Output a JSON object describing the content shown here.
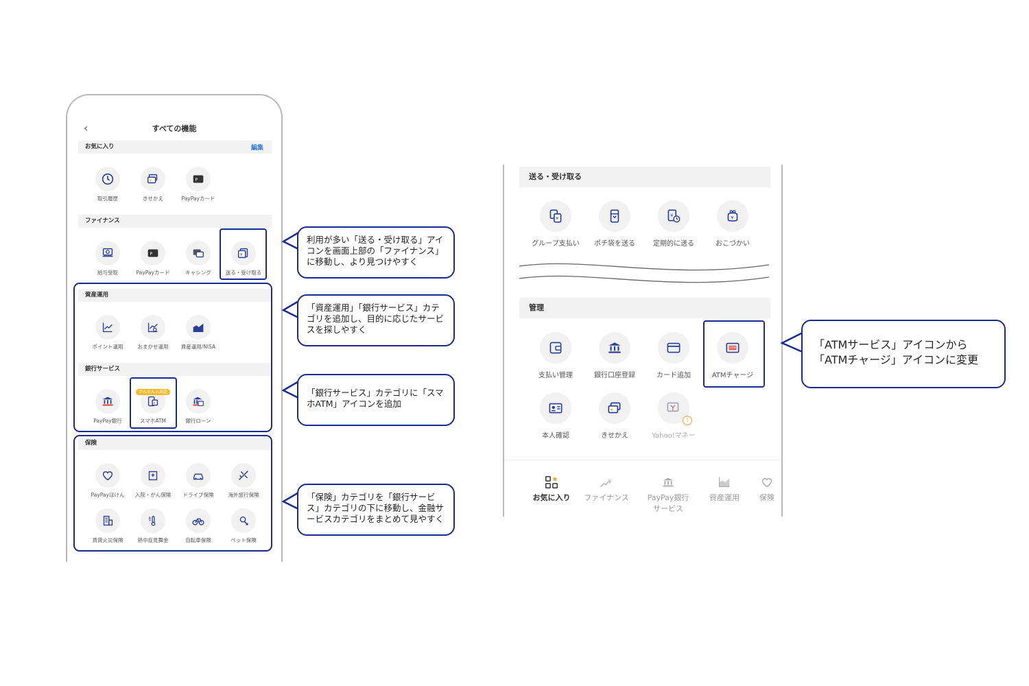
{
  "left_phone": {
    "title": "すべての機能",
    "favorites": {
      "label": "お気に入り",
      "edit": "編集",
      "items": [
        "取引履歴",
        "きせかえ",
        "PayPayカード"
      ]
    },
    "finance": {
      "label": "ファイナンス",
      "items": [
        "給与受取",
        "PayPayカード",
        "キャシング",
        "送る・受け取る"
      ]
    },
    "asset": {
      "label": "資産運用",
      "items": [
        "ポイント運用",
        "おまかせ運用",
        "資産運用/NISA"
      ]
    },
    "bank": {
      "label": "銀行サービス",
      "items": [
        "PayPay銀行",
        "スマホATM",
        "銀行ローン"
      ],
      "badge": "かんたん入出金"
    },
    "insurance": {
      "label": "保険",
      "items": [
        "PayPayほけん",
        "入院・がん保険",
        "ドライブ保険",
        "海外旅行保険",
        "賃貸火災保険",
        "熱中症見舞金",
        "自転車保険",
        "ペット保険"
      ]
    }
  },
  "callouts": {
    "c1": "利用が多い「送る・受け取る」アイコンを画面上部の「ファイナンス」に移動し、より見つけやすく",
    "c2": "「資産運用」「銀行サービス」カテゴリを追加し、目的に応じたサービスを探しやすく",
    "c3": "「銀行サービス」カテゴリに「スマホATM」アイコンを追加",
    "c4": "「保険」カテゴリを「銀行サービス」カテゴリの下に移動し、金融サービスカテゴリをまとめて見やすく",
    "c5_line1": "「ATMサービス」アイコンから",
    "c5_line2": "「ATMチャージ」アイコンに変更"
  },
  "right_phone": {
    "send": {
      "label": "送る・受け取る",
      "items": [
        "グループ支払い",
        "ポチ袋を送る",
        "定期的に送る",
        "おこづかい"
      ]
    },
    "manage": {
      "label": "管理",
      "items": [
        "支払い管理",
        "銀行口座登録",
        "カード追加",
        "ATMチャージ",
        "本人確認",
        "きせかえ",
        "Yahoo!マネー"
      ]
    },
    "tabs": [
      "お気に入り",
      "ファイナンス",
      "PayPay銀行",
      "サービス",
      "資産運用",
      "保険"
    ]
  },
  "colors": {
    "highlight": "#1b2a8f",
    "link": "#2f7bd6",
    "section_bg": "#f2f2f2",
    "badge": "#f7b92b",
    "warning": "#f0a030"
  }
}
